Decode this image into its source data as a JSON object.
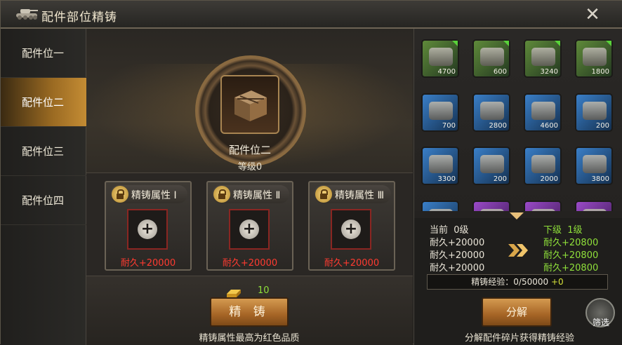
{
  "title": "配件部位精铸",
  "sidebar": {
    "items": [
      {
        "label": "配件位一"
      },
      {
        "label": "配件位二"
      },
      {
        "label": "配件位三"
      },
      {
        "label": "配件位四"
      }
    ],
    "active_index": 1
  },
  "part": {
    "name": "配件位二",
    "level": "等级0"
  },
  "attributes": [
    {
      "title": "精铸属性 Ⅰ",
      "value": "耐久+20000"
    },
    {
      "title": "精铸属性 Ⅱ",
      "value": "耐久+20000"
    },
    {
      "title": "精铸属性 Ⅲ",
      "value": "耐久+20000"
    }
  ],
  "forge": {
    "gold_count": "10",
    "button_label": "精 铸",
    "note": "精铸属性最高为红色品质"
  },
  "inventory": [
    {
      "count": "4700",
      "rarity": "green"
    },
    {
      "count": "600",
      "rarity": "green"
    },
    {
      "count": "3240",
      "rarity": "green"
    },
    {
      "count": "1800",
      "rarity": "green"
    },
    {
      "count": "700",
      "rarity": "blue"
    },
    {
      "count": "2800",
      "rarity": "blue"
    },
    {
      "count": "4600",
      "rarity": "blue"
    },
    {
      "count": "200",
      "rarity": "blue"
    },
    {
      "count": "3300",
      "rarity": "blue"
    },
    {
      "count": "200",
      "rarity": "blue"
    },
    {
      "count": "2000",
      "rarity": "blue"
    },
    {
      "count": "3800",
      "rarity": "blue"
    },
    {
      "count": "",
      "rarity": "blue"
    },
    {
      "count": "",
      "rarity": "purple"
    },
    {
      "count": "",
      "rarity": "purple"
    },
    {
      "count": "",
      "rarity": "purple"
    }
  ],
  "stats": {
    "current_label": "当前",
    "current_level": "0级",
    "current_values": [
      "耐久+20000",
      "耐久+20000",
      "耐久+20000"
    ],
    "next_label": "下级",
    "next_level": "1级",
    "next_values": [
      "耐久+20800",
      "耐久+20800",
      "耐久+20800"
    ],
    "exp_text": "精铸经验：0/50000",
    "exp_plus": "+0"
  },
  "split": {
    "button_label": "分解",
    "note": "分解配件碎片获得精铸经验"
  },
  "filter": {
    "label": "筛选"
  },
  "colors": {
    "accent_gold": "#c48c34",
    "red_value": "#ff3b30",
    "green_value": "#8fe03a"
  }
}
